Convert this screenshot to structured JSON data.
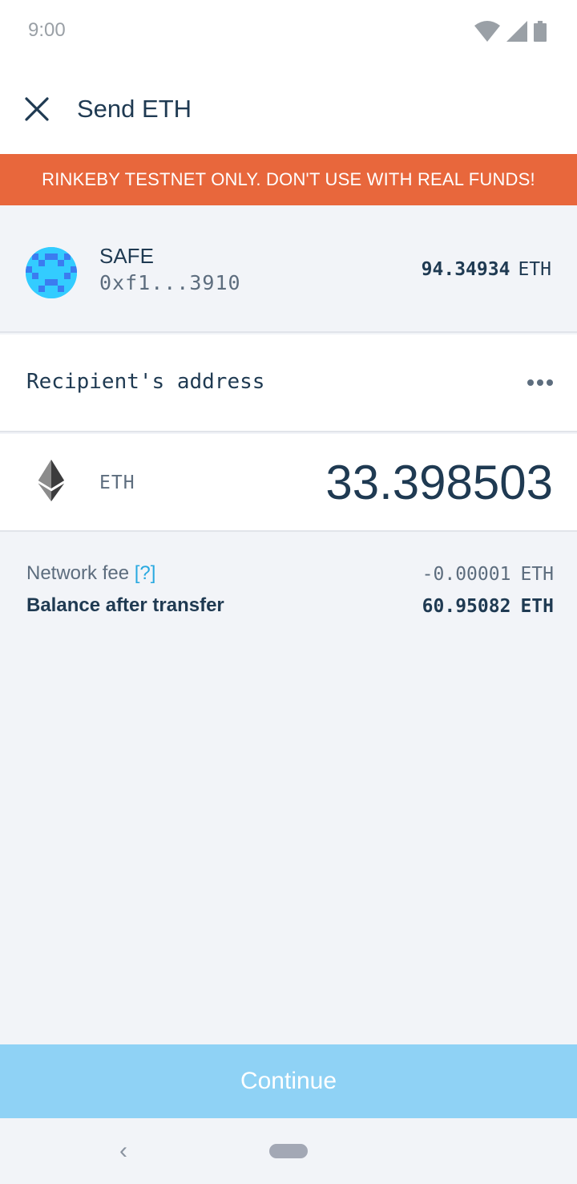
{
  "status_bar": {
    "time": "9:00"
  },
  "app_bar": {
    "title": "Send ETH"
  },
  "banner": {
    "text": "RINKEBY TESTNET ONLY. DON'T USE WITH REAL FUNDS!"
  },
  "safe": {
    "name": "SAFE",
    "address": "0xf1...3910",
    "balance": "94.34934",
    "balance_unit": "ETH"
  },
  "recipient": {
    "placeholder": "Recipient's address"
  },
  "amount": {
    "token": "ETH",
    "value": "33.398503"
  },
  "fee": {
    "label": "Network fee",
    "help": "[?]",
    "value": "-0.00001",
    "unit": "ETH"
  },
  "balance_after": {
    "label": "Balance after transfer",
    "value": "60.95082",
    "unit": "ETH"
  },
  "continue": {
    "label": "Continue"
  },
  "nav": {
    "back": "‹"
  },
  "colors": {
    "banner": "#e8673c",
    "primary_text": "#1f3a52",
    "link": "#29a9e0",
    "button_disabled": "#8fd2f5"
  }
}
